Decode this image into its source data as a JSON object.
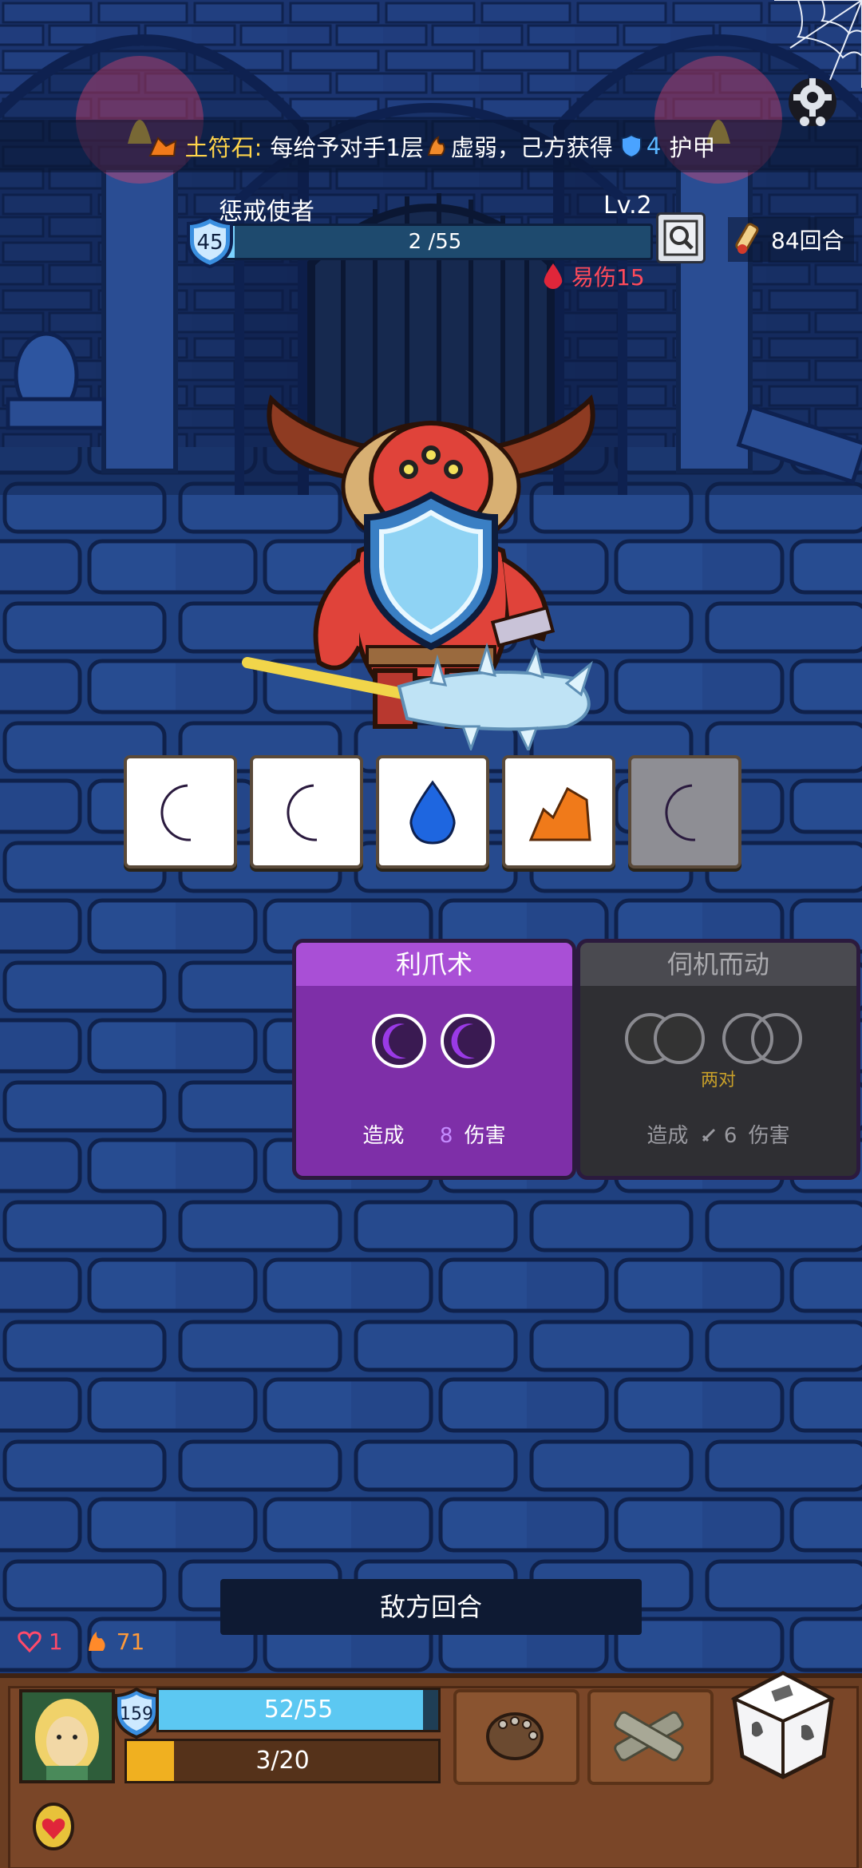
{
  "banner": {
    "stone_name": "土符石:",
    "text_part1": "每给予对手1层",
    "weak_label": "虚弱，己方获得",
    "armor_gain": "4",
    "armor_label": "护甲"
  },
  "enemy": {
    "name": "惩戒使者",
    "level": "Lv.2",
    "armor": "45",
    "hp_text": "2 /55",
    "hp_fraction": 0.036,
    "vulnerable_text": "易伤15"
  },
  "turn_counter": "84回合",
  "dice": [
    {
      "symbol": "moon-icon",
      "color": "#8b2fd6",
      "used": false
    },
    {
      "symbol": "moon-icon",
      "color": "#8b2fd6",
      "used": false
    },
    {
      "symbol": "water-drop-icon",
      "color": "#1e66e0",
      "used": false
    },
    {
      "symbol": "earth-rock-icon",
      "color": "#f07a1a",
      "used": false
    },
    {
      "symbol": "moon-icon",
      "color": "#8b2fd6",
      "used": true
    }
  ],
  "skills": [
    {
      "title": "利爪术",
      "desc_prefix": "造成",
      "damage": "8",
      "desc_suffix": "伤害",
      "active": true
    },
    {
      "title": "伺机而动",
      "requirement": "两对",
      "desc_prefix": "造成",
      "damage": "6",
      "desc_suffix": "伤害",
      "active": false
    }
  ],
  "enemy_turn_label": "敌方回合",
  "player": {
    "status_heart": "1",
    "status_fire": "71",
    "armor": "159",
    "hp_text": "52/55",
    "hp_fraction": 0.945,
    "xp_text": "3/20",
    "xp_fraction": 0.15
  },
  "colors": {
    "accent_yellow": "#ffd44a",
    "vulnerable_red": "#ff4a5a",
    "moon_purple": "#8b2fd6"
  }
}
